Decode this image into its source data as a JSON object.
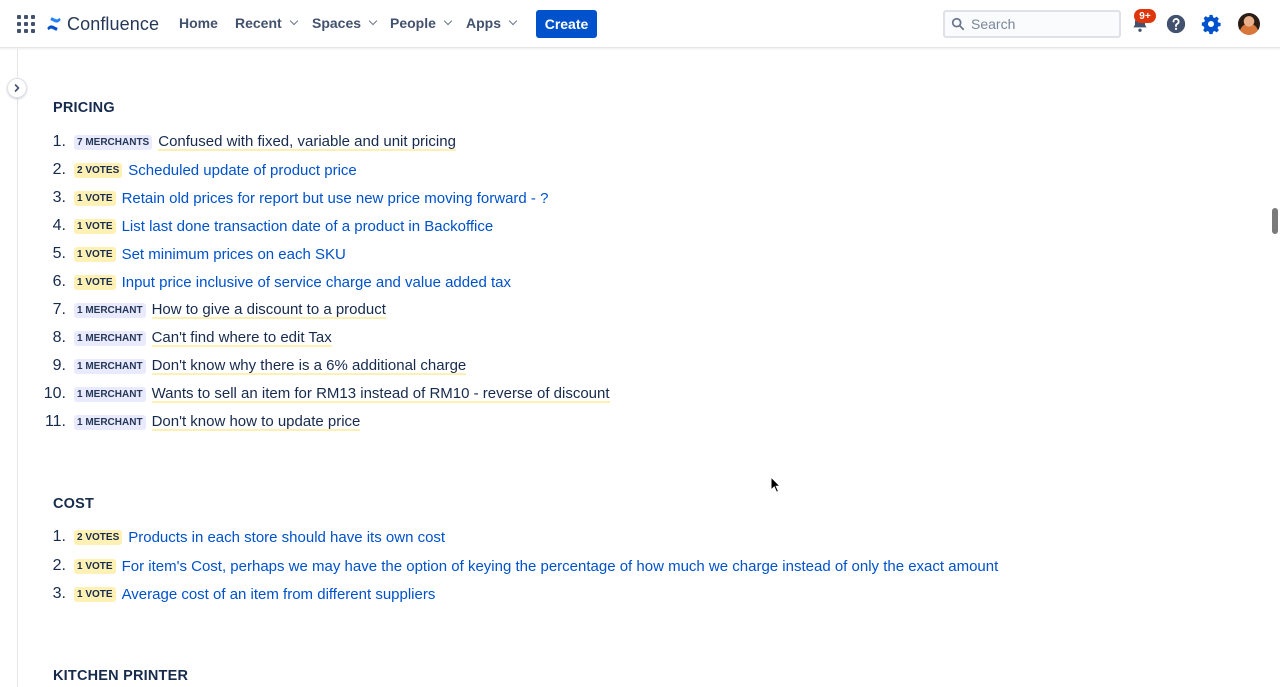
{
  "app": {
    "brand_name": "Confluence",
    "brand_color": "#0052cc"
  },
  "nav": {
    "home": "Home",
    "recent": "Recent",
    "spaces": "Spaces",
    "people": "People",
    "apps": "Apps",
    "create": "Create"
  },
  "search": {
    "placeholder": "Search"
  },
  "notifications": {
    "badge": "9+"
  },
  "icons": {
    "app_switcher": "grid-icon",
    "search": "search-icon",
    "notifications": "bell-icon",
    "help": "help-icon",
    "settings": "gear-icon",
    "sidebar_toggle": "chevron-right-icon"
  },
  "sections": [
    {
      "title": "PRICING",
      "items": [
        {
          "num": "1.",
          "tag": "7 MERCHANTS",
          "tag_kind": "merchant",
          "text": "Confused with fixed, variable and unit pricing",
          "style": "highlight"
        },
        {
          "num": "2.",
          "tag": "2 VOTES",
          "tag_kind": "vote",
          "text": "Scheduled update of product price",
          "style": "link"
        },
        {
          "num": "3.",
          "tag": "1 VOTE",
          "tag_kind": "vote",
          "text": "Retain old prices for report but use new price moving forward - ?",
          "style": "link"
        },
        {
          "num": "4.",
          "tag": "1 VOTE",
          "tag_kind": "vote",
          "text": "List last done transaction date of a product in Backoffice",
          "style": "link"
        },
        {
          "num": "5.",
          "tag": "1 VOTE",
          "tag_kind": "vote",
          "text": "Set minimum prices on each SKU",
          "style": "link"
        },
        {
          "num": "6.",
          "tag": "1 VOTE",
          "tag_kind": "vote",
          "text": "Input price inclusive of service charge and value added tax",
          "style": "link"
        },
        {
          "num": "7.",
          "tag": "1 MERCHANT",
          "tag_kind": "merchant",
          "text": "How to give a discount to a product",
          "style": "highlight"
        },
        {
          "num": "8.",
          "tag": "1 MERCHANT",
          "tag_kind": "merchant",
          "text": "Can't find where to edit Tax",
          "style": "highlight"
        },
        {
          "num": "9.",
          "tag": "1 MERCHANT",
          "tag_kind": "merchant",
          "text": "Don't know why there is a 6% additional charge",
          "style": "highlight"
        },
        {
          "num": "10.",
          "tag": "1 MERCHANT",
          "tag_kind": "merchant",
          "text": "Wants to sell an item for RM13 instead of RM10 - reverse of discount",
          "style": "highlight"
        },
        {
          "num": "11.",
          "tag": "1 MERCHANT",
          "tag_kind": "merchant",
          "text": "Don't know how to update price",
          "style": "highlight"
        }
      ]
    },
    {
      "title": "COST",
      "items": [
        {
          "num": "1.",
          "tag": "2 VOTES",
          "tag_kind": "vote",
          "text": "Products in each store should have its own cost",
          "style": "link"
        },
        {
          "num": "2.",
          "tag": "1 VOTE",
          "tag_kind": "vote",
          "text": "For item's Cost, perhaps we may have the option of keying the percentage of how much we charge instead of only the exact amount",
          "style": "link"
        },
        {
          "num": "3.",
          "tag": "1 VOTE",
          "tag_kind": "vote",
          "text": "Average cost of an item from different suppliers",
          "style": "link"
        }
      ]
    },
    {
      "title": "KITCHEN PRINTER",
      "items": []
    }
  ]
}
